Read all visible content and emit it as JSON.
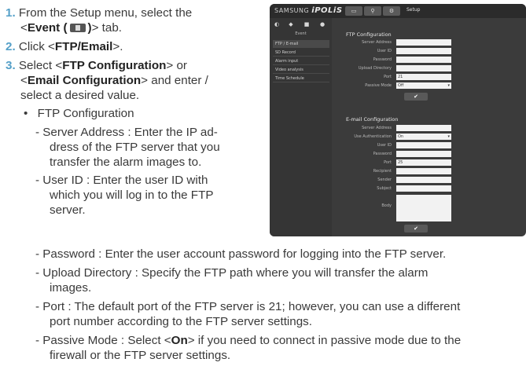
{
  "steps": {
    "s1_num": "1.",
    "s1_text_a": "From the Setup menu, select the",
    "s1_text_b_pre": "<",
    "s1_text_b_bold": "Event (",
    "s1_text_b_bold2": ")",
    "s1_text_b_post": "> tab.",
    "s2_num": "2.",
    "s2_pre": "Click <",
    "s2_bold": "FTP/Email",
    "s2_post": ">.",
    "s3_num": "3.",
    "s3_a_pre": "Select <",
    "s3_a_bold": "FTP Configuration",
    "s3_a_post": "> or",
    "s3_b_pre": "<",
    "s3_b_bold": "Email Configuration",
    "s3_b_post": "> and enter /",
    "s3_c": "select a desired value."
  },
  "bullet": {
    "mark": "•",
    "label": "FTP Configuration"
  },
  "items": [
    "- Server Address : Enter the IP ad-",
    "dress of the FTP server that you",
    "transfer the alarm images to.",
    "- User ID : Enter the user ID with",
    "which you will log in to the FTP",
    "server.",
    "- Password : Enter the user account password for logging into the FTP server.",
    "- Upload Directory : Specify the FTP path where you will transfer the alarm",
    "images.",
    "- Port : The default port of the FTP server is 21; however, you can use a different",
    "port number according to the FTP server settings.",
    "- Passive Mode : Select <",
    "On",
    "> if you need to connect in passive mode due to the",
    "firewall or the FTP server settings."
  ],
  "screenshot": {
    "brand_a": "SAMSUNG",
    "brand_b": "iPOLiS",
    "setup": "Setup",
    "event_header": "Event",
    "menu": [
      "FTP / E-mail",
      "SD Record",
      "Alarm input",
      "Video analysis",
      "Time Schedule"
    ],
    "ftp_title": "FTP Configuration",
    "ftp_labels": [
      "Server Address",
      "User ID",
      "Password",
      "Upload Directory",
      "Port",
      "Passive Mode"
    ],
    "port_value": "21",
    "passive_value": "Off",
    "email_title": "E-mail Configuration",
    "email_labels": [
      "Server Address",
      "Use Authentication",
      "User ID",
      "Password",
      "Port",
      "Recipient",
      "Sender",
      "Subject",
      "Body"
    ],
    "auth_value": "On",
    "email_port_value": "25",
    "ok": "✔"
  }
}
